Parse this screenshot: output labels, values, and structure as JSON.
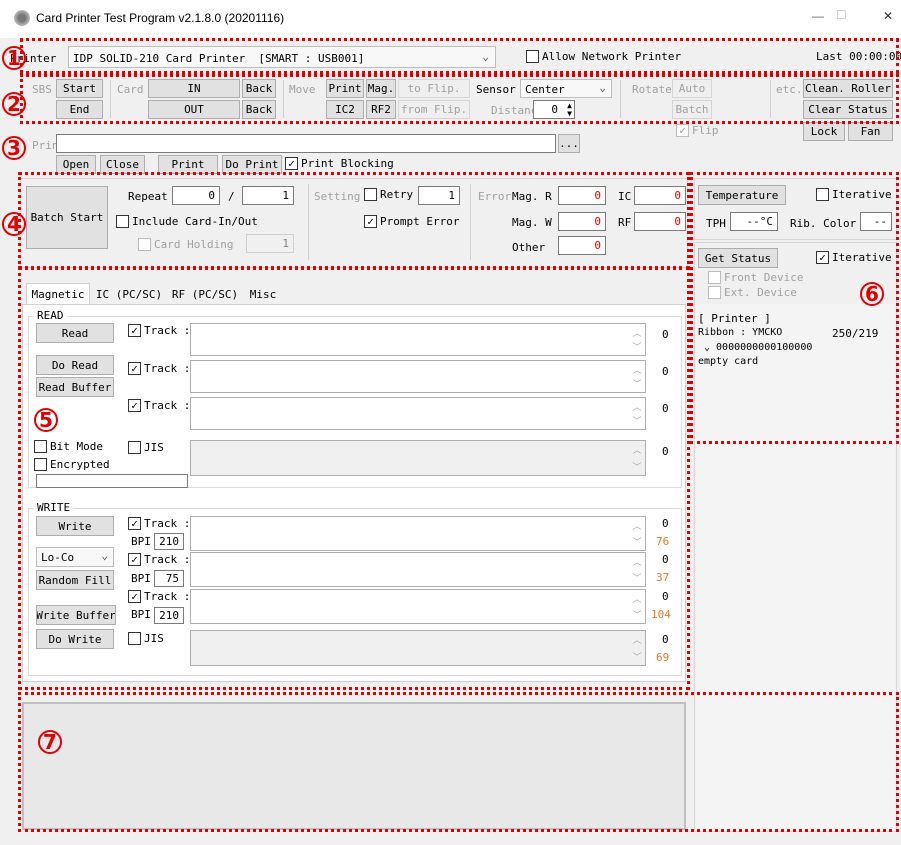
{
  "window": {
    "title": "Card Printer Test Program v2.1.8.0 (20201116)",
    "minimize": "—",
    "maximize": "☐",
    "close": "✕"
  },
  "printer_row": {
    "label": "Printer",
    "selected": "IDP SOLID-210 Card Printer  [SMART : USB001]",
    "allow_network": "Allow Network Printer",
    "last": "Last 00:00:00"
  },
  "sbs": {
    "label": "SBS",
    "start": "Start",
    "end": "End"
  },
  "card": {
    "label": "Card",
    "in": "IN",
    "out": "OUT",
    "back1": "Back",
    "back2": "Back"
  },
  "move": {
    "label": "Move",
    "print": "Print",
    "mag": "Mag.",
    "to_flip": "to Flip.",
    "ic2": "IC2",
    "rf2": "RF2",
    "from_flip": "from Flip."
  },
  "sensor": {
    "label": "Sensor",
    "selected": "Center",
    "distance_label": "Distanc",
    "distance_value": "0"
  },
  "rotate": {
    "label": "Rotate",
    "auto": "Auto",
    "batch": "Batch",
    "flip": "Flip"
  },
  "etc": {
    "label": "etc.",
    "clean_roller": "Clean. Roller",
    "clear_status": "Clear Status",
    "lock": "Lock",
    "fan": "Fan"
  },
  "print_row": {
    "label": "Prin",
    "file_value": "",
    "browse": "...",
    "open": "Open",
    "close": "Close",
    "print": "Print",
    "do_print": "Do Print",
    "print_blocking": "Print Blocking"
  },
  "batch": {
    "start": "Batch Start",
    "repeat_label": "Repeat",
    "repeat_value": "0",
    "slash": "/",
    "repeat_total": "1",
    "include_card": "Include Card-In/Out",
    "card_holding": "Card Holding",
    "card_holding_value": "1",
    "setting_label": "Setting",
    "retry": "Retry",
    "retry_value": "1",
    "prompt_error": "Prompt Error",
    "error_label": "Error",
    "mag_r": "Mag. R",
    "mag_r_value": "0",
    "mag_w": "Mag. W",
    "mag_w_value": "0",
    "other": "Other",
    "other_value": "0",
    "ic": "IC",
    "ic_value": "0",
    "rf": "RF",
    "rf_value": "0"
  },
  "tabs": [
    "Magnetic",
    "IC (PC/SC)",
    "RF (PC/SC)",
    "Misc"
  ],
  "read": {
    "group": "READ",
    "read": "Read",
    "do_read": "Do Read",
    "read_buffer": "Read Buffer",
    "track": "Track",
    "colon": ":",
    "counts": [
      "0",
      "0",
      "0",
      "0"
    ],
    "bit_mode": "Bit Mode",
    "encrypted": "Encrypted",
    "jis": "JIS"
  },
  "write": {
    "group": "WRITE",
    "write": "Write",
    "loco": "Lo-Co",
    "random_fill": "Random Fill",
    "write_buffer": "Write Buffer",
    "do_write": "Do Write",
    "track": "Track",
    "colon": ":",
    "bpi": "BPI",
    "bpi_values": [
      "210",
      "75",
      "210"
    ],
    "jis": "JIS",
    "counts": [
      "0",
      "0",
      "0",
      "0"
    ],
    "limits": [
      "76",
      "37",
      "104",
      "69"
    ]
  },
  "right": {
    "temperature": "Temperature",
    "iterative1": "Iterative",
    "tph": "TPH",
    "tph_value": "--°C",
    "rib_color": "Rib. Color",
    "rib_value": "--",
    "get_status": "Get Status",
    "iterative2": "Iterative",
    "front_device": "Front Device",
    "ext_device": "Ext. Device",
    "status_lines": [
      "[ Printer ]",
      "Ribbon : YMCKO",
      "250/219",
      "⌄  0000000000100000",
      "empty card"
    ]
  },
  "markers": [
    "1",
    "2",
    "3",
    "4",
    "5",
    "6",
    "7"
  ],
  "colors": {
    "annotation": "#e00000",
    "counter_orange": "#e07a2a"
  }
}
